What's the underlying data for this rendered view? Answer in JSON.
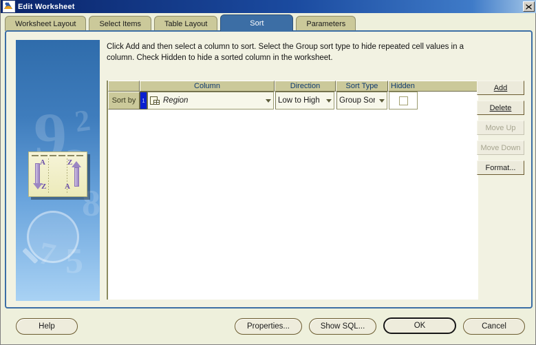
{
  "window": {
    "title": "Edit Worksheet",
    "app_icon": "worksheet-icon",
    "close_label": "×"
  },
  "tabs": [
    {
      "label": "Worksheet Layout",
      "active": false
    },
    {
      "label": "Select Items",
      "active": false
    },
    {
      "label": "Table Layout",
      "active": false
    },
    {
      "label": "Sort",
      "active": true
    },
    {
      "label": "Parameters",
      "active": false
    }
  ],
  "instructions": "Click Add and then select a column to sort. Select the Group sort type to hide repeated cell values in a column. Check Hidden to hide a sorted column in the worksheet.",
  "illustration": {
    "name": "sort-illustration",
    "card_labels": {
      "left_top": "A",
      "left_bottom": "Z",
      "right_top": "Z",
      "right_bottom": "A"
    },
    "background_glyphs": [
      "9",
      "2",
      "3",
      "8",
      "5",
      "7"
    ]
  },
  "grid": {
    "headers": [
      "",
      "Column",
      "Direction",
      "Sort Type",
      "Hidden"
    ],
    "rows": [
      {
        "sort_by_label": "Sort by",
        "marker": "1",
        "column": "Region",
        "column_icon": "table-column-icon",
        "direction": "Low to High",
        "sort_type": "Group Sort",
        "hidden_checked": false
      }
    ]
  },
  "side_buttons": [
    {
      "name": "add-button",
      "label": "Add",
      "accel": "A",
      "enabled": true
    },
    {
      "name": "delete-button",
      "label": "Delete",
      "accel": "D",
      "enabled": true
    },
    {
      "name": "move-up-button",
      "label": "Move Up",
      "accel": "U",
      "enabled": false
    },
    {
      "name": "move-down-button",
      "label": "Move Down",
      "accel": "D",
      "enabled": false
    },
    {
      "name": "format-button",
      "label": "Format...",
      "accel": "o",
      "enabled": true
    }
  ],
  "footer_buttons": {
    "help": "Help",
    "properties": "Properties...",
    "show_sql": "Show SQL...",
    "ok": "OK",
    "cancel": "Cancel"
  },
  "colors": {
    "titlebar_start": "#0a246a",
    "tab_inactive": "#cbc99a",
    "tab_active": "#3c6ea5",
    "panel_bg": "#f2f2e2",
    "panel_border": "#3c6ea5",
    "header_text": "#0f3a6e",
    "marker_blue": "#0a1fd0"
  }
}
